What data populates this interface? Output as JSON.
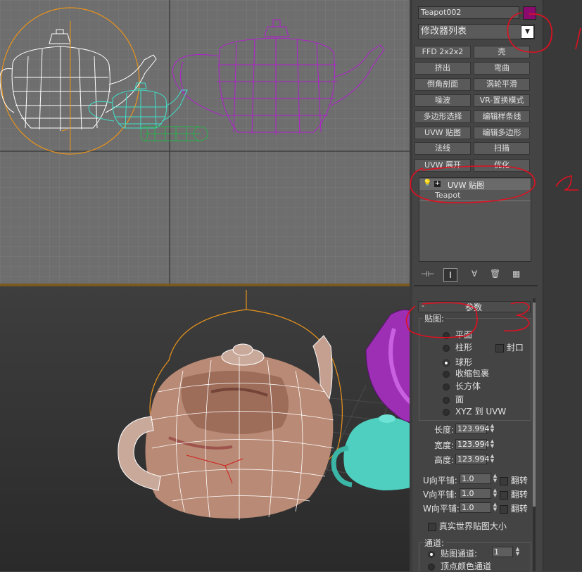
{
  "object_name": "Teapot002",
  "object_color": "#8a0b6d",
  "modifier_list": "修改器列表",
  "modifier_buttons": [
    "FFD 2x2x2",
    "壳",
    "挤出",
    "弯曲",
    "倒角剖面",
    "涡轮平滑",
    "噪波",
    "VR-置换模式",
    "多边形选择",
    "编辑样条线",
    "UVW 贴图",
    "编辑多边形",
    "法线",
    "扫描",
    "UVW 展开",
    "优化"
  ],
  "stack": {
    "modifier": "UVW 贴图",
    "base": "Teapot"
  },
  "rollout": {
    "title": "参数",
    "mapping_label": "贴图:"
  },
  "mapping_types": [
    {
      "label": "平面",
      "selected": false
    },
    {
      "label": "柱形",
      "selected": false
    },
    {
      "label": "球形",
      "selected": true
    },
    {
      "label": "收缩包裹",
      "selected": false
    },
    {
      "label": "长方体",
      "selected": false
    },
    {
      "label": "面",
      "selected": false
    },
    {
      "label": "XYZ 到 UVW",
      "selected": false
    }
  ],
  "cap_label": "封口",
  "dims": [
    {
      "label": "长度:",
      "value": "123.994"
    },
    {
      "label": "宽度:",
      "value": "123.994"
    },
    {
      "label": "高度:",
      "value": "123.994"
    }
  ],
  "tiles": [
    {
      "label": "U向平铺:",
      "value": "1.0",
      "flip": "翻转"
    },
    {
      "label": "V向平铺:",
      "value": "1.0",
      "flip": "翻转"
    },
    {
      "label": "W向平铺:",
      "value": "1.0",
      "flip": "翻转"
    }
  ],
  "real_world": "真实世界贴图大小",
  "channel": {
    "title": "通道:",
    "map_channel": "贴图通道:",
    "map_channel_value": "1",
    "vertex_color": "顶点颜色通道"
  },
  "annotations": [
    "1",
    "2",
    "3"
  ],
  "colors": {
    "orange_select": "#e8931c",
    "wire_white": "#ffffff",
    "wire_purple": "#b21fd0",
    "wire_cyan": "#3fe0c8",
    "wire_green": "#27b24a",
    "teapot_skin": "#b98a75"
  }
}
